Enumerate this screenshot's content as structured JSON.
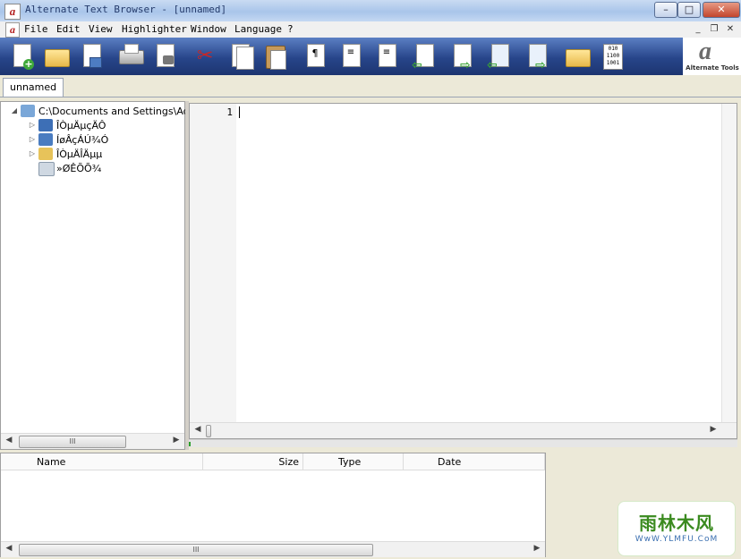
{
  "window": {
    "title": "Alternate Text Browser  - [unnamed]",
    "minimize": "–",
    "maximize": "□",
    "close": "✕"
  },
  "menu": {
    "items": [
      "File",
      "Edit",
      "View",
      "Highlighter",
      "Window",
      "Language",
      "?"
    ],
    "mdi_minimize": "_",
    "mdi_restore": "❐",
    "mdi_close": "✕"
  },
  "toolbar": {
    "buttons": [
      {
        "name": "new-file-button",
        "icon": "new-file-icon"
      },
      {
        "name": "open-button",
        "icon": "open-folder-icon"
      },
      {
        "name": "save-button",
        "icon": "save-icon"
      },
      {
        "name": "print-button",
        "icon": "printer-icon"
      },
      {
        "name": "print-preview-button",
        "icon": "print-preview-icon"
      },
      {
        "name": "cut-button",
        "icon": "scissors-icon"
      },
      {
        "name": "copy-button",
        "icon": "copy-icon"
      },
      {
        "name": "paste-button",
        "icon": "paste-icon"
      },
      {
        "name": "paragraph-button",
        "icon": "pilcrow-icon"
      },
      {
        "name": "align-left-button",
        "icon": "align-left-icon"
      },
      {
        "name": "align-right-button",
        "icon": "align-right-icon"
      },
      {
        "name": "back-button",
        "icon": "arrow-left-icon"
      },
      {
        "name": "forward-button",
        "icon": "arrow-right-icon"
      },
      {
        "name": "first-button",
        "icon": "arrow-first-icon"
      },
      {
        "name": "last-button",
        "icon": "arrow-last-icon"
      },
      {
        "name": "browse-folder-button",
        "icon": "folder-icon"
      },
      {
        "name": "binary-view-button",
        "icon": "binary-icon"
      }
    ],
    "pilcrow": "¶",
    "binary_text": "010 1100 1001",
    "logo_mark": "a",
    "logo_text": "Alternate Tools"
  },
  "tabs": {
    "active": "unnamed"
  },
  "tree": {
    "root": "C:\\Documents and Settings\\Admir",
    "children": [
      "ÎÒµÄµçÄÔ",
      "ÍøÂçÁÚ¾Ó",
      "ÎÒµÄÎÄµµ",
      "»ØÊÕÕ¾"
    ]
  },
  "editor": {
    "line_number": "1"
  },
  "scrollbars": {
    "thumb_grip": "III",
    "left_arrow": "◀",
    "right_arrow": "▶"
  },
  "file_list": {
    "columns": [
      "Name",
      "Size",
      "Type",
      "Date"
    ]
  },
  "watermark": {
    "main": "雨林木风",
    "sub": "WwW.YLMFU.CoM"
  }
}
